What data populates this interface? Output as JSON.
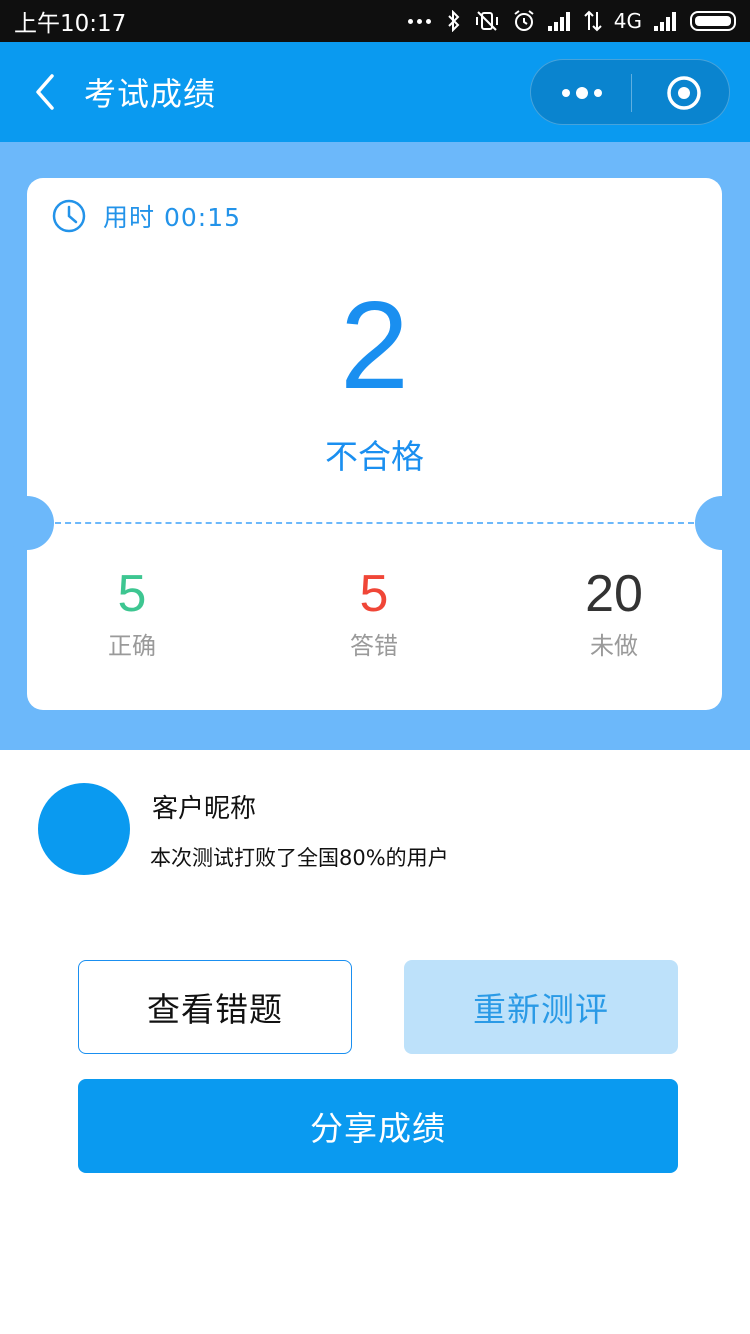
{
  "status_bar": {
    "time": "上午10:17",
    "network": "4G",
    "icons": [
      "more-dots-icon",
      "bluetooth-icon",
      "vibrate-off-icon",
      "alarm-icon",
      "signal-icon",
      "data-arrows-icon",
      "signal-icon",
      "battery-icon"
    ]
  },
  "nav": {
    "title": "考试成绩",
    "back_icon": "chevron-left-icon",
    "more_icon": "more-dots-icon",
    "close_icon": "target-circle-icon"
  },
  "result": {
    "time_label": "用时",
    "time_value": "00:15",
    "score": "2",
    "status": "不合格",
    "stats": [
      {
        "value": "5",
        "label": "正确",
        "color": "#3dc691"
      },
      {
        "value": "5",
        "label": "答错",
        "color": "#f04637"
      },
      {
        "value": "20",
        "label": "未做",
        "color": "#333333"
      }
    ]
  },
  "user": {
    "nickname": "客户昵称",
    "beat_text": "本次测试打败了全国80%的用户"
  },
  "actions": {
    "review_label": "查看错题",
    "retest_label": "重新测评",
    "share_label": "分享成绩"
  },
  "colors": {
    "primary": "#0a9af0",
    "panel_bg": "#6cb8fa",
    "correct": "#3dc691",
    "wrong": "#f04637"
  }
}
